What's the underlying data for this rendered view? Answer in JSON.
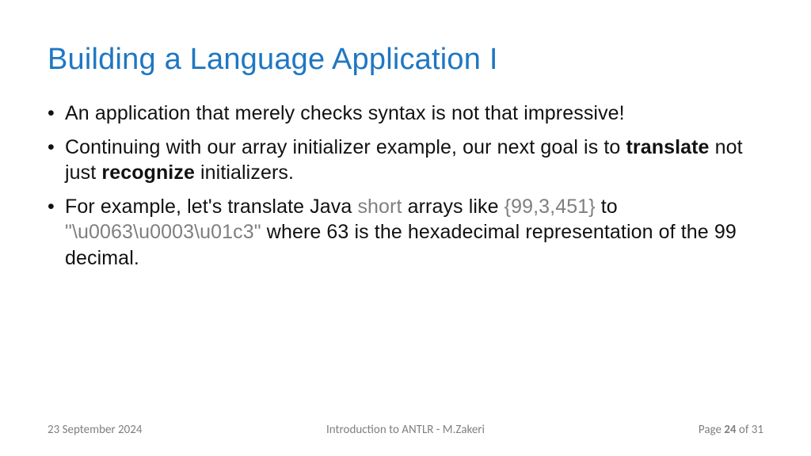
{
  "title": "Building a Language Application I",
  "bullets": {
    "b1": "An application that merely checks syntax is not that impressive!",
    "b2_pre": "Continuing with our array initializer example, our next goal is to ",
    "b2_bold1": "translate",
    "b2_mid": " not just ",
    "b2_bold2": "recognize",
    "b2_post": " initializers.",
    "b3_pre": "For example, let's translate Java ",
    "b3_grey1": "short",
    "b3_mid1": " arrays like ",
    "b3_grey2": "{99,3,451}",
    "b3_mid2": " to ",
    "b3_grey3": "\"\\u0063\\u0003\\u01c3\"",
    "b3_post": " where 63 is the hexadecimal representation of the 99 decimal."
  },
  "footer": {
    "date": "23 September 2024",
    "center": "Introduction to ANTLR - M.Zakeri",
    "page_label": "Page ",
    "page_num": "24",
    "page_of": " of 31"
  }
}
